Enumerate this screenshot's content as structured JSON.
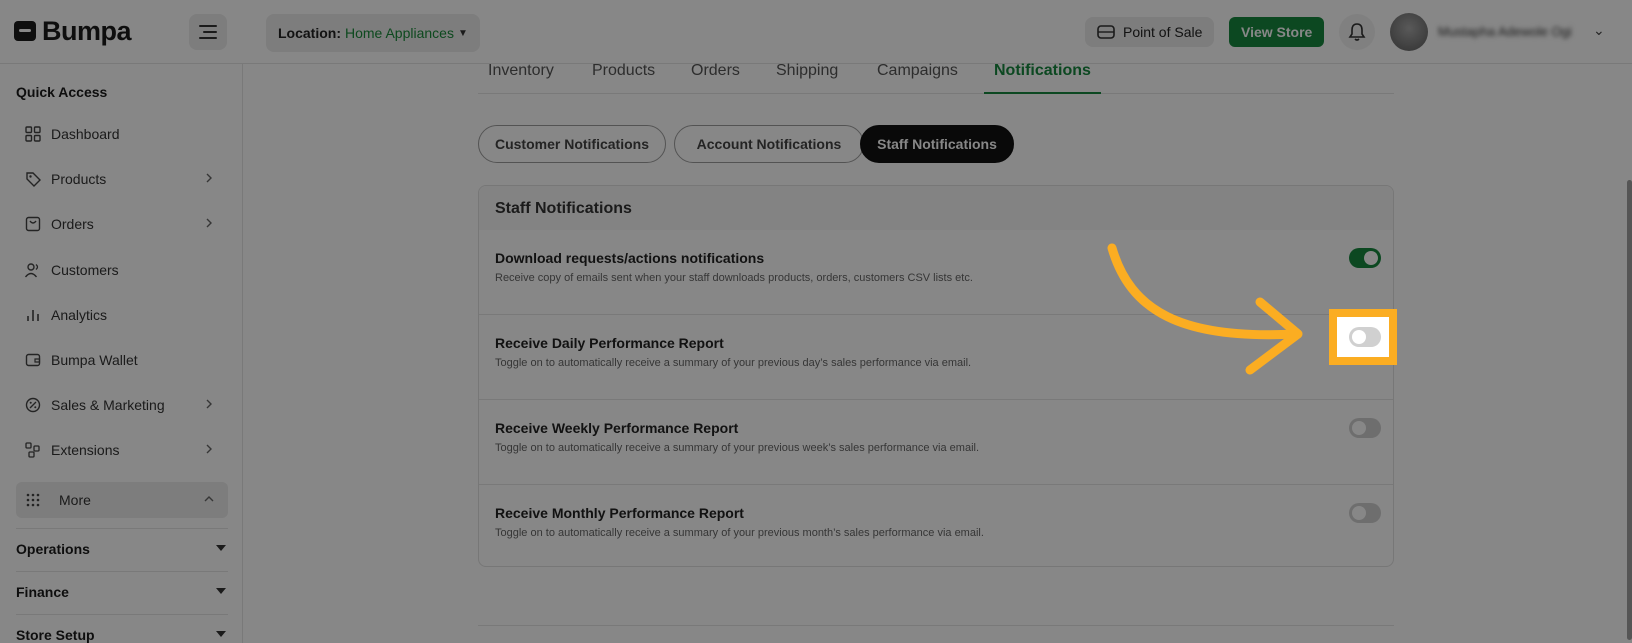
{
  "brand": {
    "name": "Bumpa"
  },
  "header": {
    "location_label": "Location:",
    "location_value": "Home Appliances",
    "pos_label": "Point of Sale",
    "view_store_label": "View Store",
    "user_name": "Mustapha Adewole Ogi"
  },
  "sidebar": {
    "quick_access_title": "Quick Access",
    "items": [
      {
        "label": "Dashboard",
        "icon": "grid-icon"
      },
      {
        "label": "Products",
        "icon": "tag-icon"
      },
      {
        "label": "Orders",
        "icon": "inbox-icon"
      },
      {
        "label": "Customers",
        "icon": "users-icon"
      },
      {
        "label": "Analytics",
        "icon": "bar-chart-icon"
      },
      {
        "label": "Bumpa Wallet",
        "icon": "wallet-icon"
      },
      {
        "label": "Sales & Marketing",
        "icon": "percent-icon"
      },
      {
        "label": "Extensions",
        "icon": "extensions-icon"
      },
      {
        "label": "More",
        "icon": "dots-grid-icon"
      }
    ],
    "groups": [
      {
        "label": "Operations"
      },
      {
        "label": "Finance"
      },
      {
        "label": "Store Setup"
      }
    ]
  },
  "tabs": [
    {
      "label": "Inventory"
    },
    {
      "label": "Products"
    },
    {
      "label": "Orders"
    },
    {
      "label": "Shipping"
    },
    {
      "label": "Campaigns"
    },
    {
      "label": "Notifications",
      "active": true
    }
  ],
  "subtabs": [
    {
      "label": "Customer Notifications"
    },
    {
      "label": "Account Notifications"
    },
    {
      "label": "Staff Notifications",
      "active": true
    }
  ],
  "card": {
    "title": "Staff Notifications",
    "rows": [
      {
        "title": "Download requests/actions notifications",
        "desc": "Receive copy of emails sent when your staff downloads products, orders, customers CSV lists etc.",
        "enabled": true
      },
      {
        "title": "Receive Daily Performance Report",
        "desc": "Toggle on to automatically receive a summary of your previous day’s sales performance via email.",
        "enabled": false
      },
      {
        "title": "Receive Weekly Performance Report",
        "desc": "Toggle on to automatically receive a summary of your previous week’s sales performance via email.",
        "enabled": false
      },
      {
        "title": "Receive Monthly Performance Report",
        "desc": "Toggle on to automatically receive a summary of your previous month’s sales performance via email.",
        "enabled": false
      }
    ]
  },
  "colors": {
    "brand_green": "#17883f",
    "highlight": "#fbad22"
  }
}
